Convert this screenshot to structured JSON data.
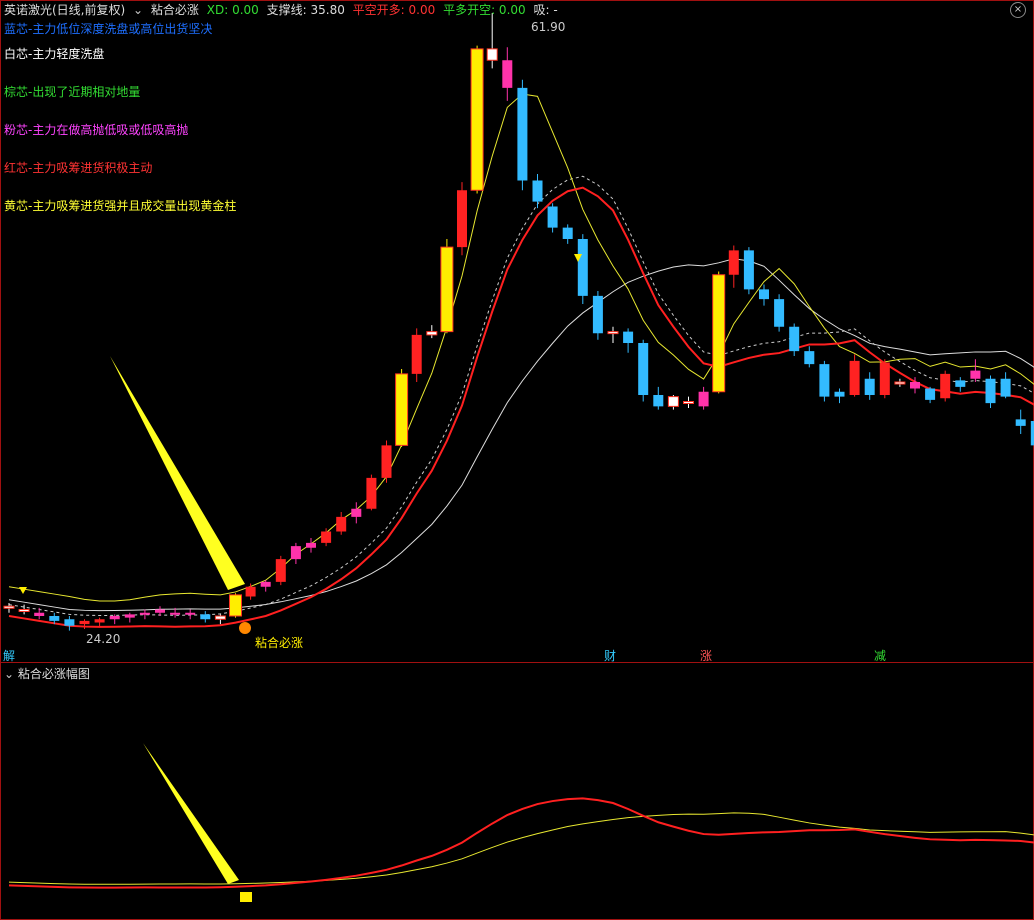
{
  "header": {
    "title": "英诺激光(日线,前复权)",
    "indicator_name": "粘合必涨",
    "xd": "XD: 0.00",
    "support": "支撑线: 35.80",
    "short_open": "平空开多: 0.00",
    "long_open": "平多开空: 0.00",
    "absorb": "吸: -"
  },
  "legend": [
    {
      "text": "蓝芯-主力低位深度洗盘或高位出货坚决",
      "color": "#1e6fff"
    },
    {
      "text": "白芯-主力轻度洗盘",
      "color": "#ffffff"
    },
    {
      "text": "棕芯-出现了近期相对地量",
      "color": "#33dd33"
    },
    {
      "text": "粉芯-主力在做高抛低吸或低吸高抛",
      "color": "#ff44ff"
    },
    {
      "text": "红芯-主力吸筹进货积极主动",
      "color": "#ff3333"
    },
    {
      "text": "黄芯-主力吸筹进货强并且成交量出现黄金柱",
      "color": "#ffff33"
    }
  ],
  "price_labels": {
    "high": "61.90",
    "low": "24.20"
  },
  "signal_label": "粘合必涨",
  "time_markers": [
    {
      "text": "解",
      "color": "#33ccff"
    },
    {
      "text": "财",
      "color": "#33ccff"
    },
    {
      "text": "涨",
      "color": "#ff5555"
    },
    {
      "text": "减",
      "color": "#33dd33"
    }
  ],
  "sub_panel": {
    "title": "粘合必涨幅图"
  },
  "colors": {
    "up": "#ff2222",
    "down": "#33bbff",
    "gold": "#ffee00",
    "pink": "#ff33aa",
    "white": "#ffffff"
  },
  "chart_data": {
    "type": "candlestick",
    "candles": [
      [
        25.3,
        25.6,
        25.0,
        25.4,
        "white"
      ],
      [
        25.2,
        25.5,
        24.9,
        25.1,
        "white"
      ],
      [
        25.0,
        25.3,
        24.6,
        24.8,
        "pink"
      ],
      [
        24.8,
        25.0,
        24.3,
        24.5,
        "down"
      ],
      [
        24.6,
        24.8,
        23.9,
        24.2,
        "down"
      ],
      [
        24.3,
        24.6,
        24.0,
        24.5,
        "up"
      ],
      [
        24.4,
        24.7,
        24.1,
        24.6,
        "up"
      ],
      [
        24.6,
        24.9,
        24.3,
        24.8,
        "pink"
      ],
      [
        24.7,
        25.0,
        24.4,
        24.9,
        "pink"
      ],
      [
        24.9,
        25.2,
        24.6,
        25.0,
        "pink"
      ],
      [
        25.0,
        25.4,
        24.8,
        25.2,
        "pink"
      ],
      [
        25.0,
        25.3,
        24.7,
        24.9,
        "pink"
      ],
      [
        24.9,
        25.2,
        24.6,
        25.0,
        "pink"
      ],
      [
        24.9,
        25.1,
        24.4,
        24.6,
        "down"
      ],
      [
        24.6,
        24.9,
        24.3,
        24.8,
        "white"
      ],
      [
        24.8,
        26.2,
        24.7,
        26.1,
        "gold"
      ],
      [
        26.0,
        26.8,
        25.8,
        26.6,
        "up"
      ],
      [
        26.6,
        27.0,
        26.3,
        26.9,
        "pink"
      ],
      [
        26.9,
        28.5,
        26.7,
        28.3,
        "up"
      ],
      [
        28.3,
        29.3,
        28.0,
        29.1,
        "pink"
      ],
      [
        29.0,
        29.6,
        28.7,
        29.3,
        "pink"
      ],
      [
        29.3,
        30.2,
        29.1,
        30.0,
        "up"
      ],
      [
        30.0,
        31.2,
        29.8,
        30.9,
        "up"
      ],
      [
        30.9,
        31.8,
        30.5,
        31.4,
        "pink"
      ],
      [
        31.4,
        33.5,
        31.3,
        33.3,
        "up"
      ],
      [
        33.3,
        35.6,
        33.0,
        35.3,
        "up"
      ],
      [
        35.3,
        40.0,
        35.2,
        39.7,
        "gold"
      ],
      [
        39.7,
        42.5,
        39.2,
        42.1,
        "up"
      ],
      [
        42.1,
        42.7,
        41.9,
        42.3,
        "white"
      ],
      [
        42.3,
        48.0,
        42.2,
        47.5,
        "gold"
      ],
      [
        47.5,
        51.5,
        47.0,
        51.0,
        "up"
      ],
      [
        51.0,
        59.9,
        50.8,
        59.7,
        "gold"
      ],
      [
        59.7,
        61.9,
        58.5,
        59.0,
        "white"
      ],
      [
        59.0,
        59.8,
        56.5,
        57.3,
        "pink"
      ],
      [
        57.3,
        57.8,
        51.0,
        51.6,
        "down"
      ],
      [
        51.6,
        52.0,
        49.9,
        50.3,
        "down"
      ],
      [
        50.0,
        50.2,
        48.4,
        48.7,
        "down"
      ],
      [
        48.7,
        48.9,
        47.7,
        48.0,
        "down"
      ],
      [
        48.0,
        48.3,
        44.0,
        44.5,
        "down"
      ],
      [
        44.5,
        44.8,
        41.8,
        42.2,
        "down"
      ],
      [
        42.2,
        42.6,
        41.6,
        42.3,
        "white"
      ],
      [
        42.3,
        42.5,
        41.0,
        41.6,
        "down"
      ],
      [
        41.6,
        41.8,
        38.0,
        38.4,
        "down"
      ],
      [
        38.4,
        38.9,
        37.5,
        37.7,
        "down"
      ],
      [
        37.7,
        38.4,
        37.5,
        38.3,
        "white"
      ],
      [
        38.0,
        38.3,
        37.6,
        37.9,
        "white"
      ],
      [
        37.7,
        38.9,
        37.5,
        38.6,
        "pink"
      ],
      [
        38.6,
        46.0,
        38.5,
        45.8,
        "gold"
      ],
      [
        45.8,
        47.6,
        45.0,
        47.3,
        "up"
      ],
      [
        47.3,
        47.5,
        44.6,
        44.9,
        "down"
      ],
      [
        44.9,
        45.2,
        43.9,
        44.3,
        "down"
      ],
      [
        44.3,
        44.6,
        42.3,
        42.6,
        "down"
      ],
      [
        42.6,
        42.8,
        40.8,
        41.1,
        "down"
      ],
      [
        41.1,
        41.4,
        40.1,
        40.3,
        "down"
      ],
      [
        40.3,
        40.5,
        38.0,
        38.3,
        "down"
      ],
      [
        38.3,
        38.8,
        37.9,
        38.6,
        "down"
      ],
      [
        38.4,
        40.9,
        38.3,
        40.5,
        "up"
      ],
      [
        39.4,
        39.8,
        38.1,
        38.4,
        "down"
      ],
      [
        38.4,
        40.6,
        38.2,
        40.4,
        "up"
      ],
      [
        39.2,
        39.4,
        38.9,
        39.1,
        "white"
      ],
      [
        39.2,
        39.5,
        38.5,
        38.8,
        "pink"
      ],
      [
        38.8,
        38.9,
        37.9,
        38.1,
        "down"
      ],
      [
        38.2,
        39.9,
        38.0,
        39.7,
        "up"
      ],
      [
        39.3,
        39.5,
        38.6,
        38.9,
        "down"
      ],
      [
        39.9,
        40.6,
        39.2,
        39.4,
        "pink"
      ],
      [
        39.4,
        39.6,
        37.6,
        37.9,
        "down"
      ],
      [
        38.3,
        39.8,
        38.2,
        39.4,
        "down"
      ],
      [
        36.5,
        37.5,
        36.0,
        36.9,
        "down"
      ],
      [
        36.8,
        37.2,
        35.0,
        35.3,
        "down"
      ]
    ]
  }
}
